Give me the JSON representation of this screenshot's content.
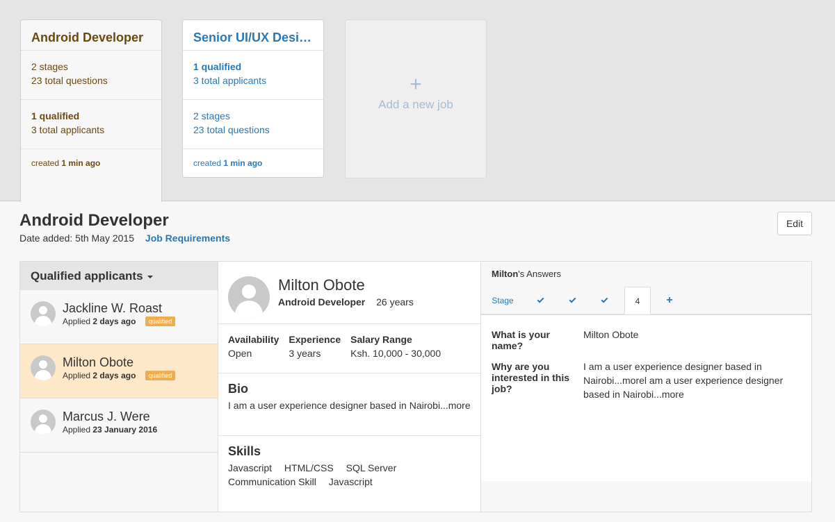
{
  "job_cards": [
    {
      "title": "Android Developer",
      "block1_line1": "2 stages",
      "block1_line2": "23 total questions",
      "block2_line1": "1 qualified",
      "block2_line2": "3 total applicants",
      "created_prefix": "created",
      "created_value": "1 min ago"
    },
    {
      "title": "Senior UI/UX Designer",
      "block1_line1": "1 qualified",
      "block1_line2": "3 total applicants",
      "block2_line1": "2 stages",
      "block2_line2": "23 total questions",
      "created_prefix": "created",
      "created_value": "1 min ago"
    }
  ],
  "add_job": {
    "icon": "+",
    "label": "Add a new job"
  },
  "job_header": {
    "title": "Android Developer",
    "date_added": "Date added: 5th May 2015",
    "requirements_link": "Job Requirements",
    "edit_label": "Edit"
  },
  "applicants_panel": {
    "heading": "Qualified applicants",
    "applicants": [
      {
        "name": "Jackline W. Roast",
        "applied_prefix": "Applied",
        "applied_value": "2 days ago",
        "badge": "qualified"
      },
      {
        "name": "Milton Obote",
        "applied_prefix": "Applied",
        "applied_value": "2 days ago",
        "badge": "qualified"
      },
      {
        "name": "Marcus J. Were",
        "applied_prefix": "Applied",
        "applied_value": "23 January 2016"
      }
    ]
  },
  "profile": {
    "name": "Milton Obote",
    "role": "Android Developer",
    "age": "26 years",
    "facts": [
      {
        "label": "Availability",
        "value": "Open"
      },
      {
        "label": "Experience",
        "value": "3 years"
      },
      {
        "label": "Salary Range",
        "value": "Ksh. 10,000 - 30,000"
      }
    ],
    "bio_title": "Bio",
    "bio_text": "I am a user experience designer based in Nairobi",
    "bio_more": "...more",
    "skills_title": "Skills",
    "skills": [
      "Javascript",
      "HTML/CSS",
      "SQL Server",
      "Communication Skill",
      "Javascript"
    ]
  },
  "answers_panel": {
    "who_name": "Milton",
    "who_suffix": "'s Answers",
    "tabs": {
      "stage_label": "Stage",
      "current_stage": "4",
      "add": "+"
    },
    "questions": [
      {
        "q": "What is your name?",
        "a": "Milton Obote",
        "more": ""
      },
      {
        "q": "Why are you interested in this job?",
        "a": "I am a user experience designer based in Nairobi...morel am a user experience designer based in Nairobi",
        "more": "...more"
      }
    ]
  },
  "colors": {
    "brown": "#6b4a10",
    "blue": "#2b78b7",
    "selected_row": "#fde8c9",
    "badge": "#f0ad4e"
  }
}
